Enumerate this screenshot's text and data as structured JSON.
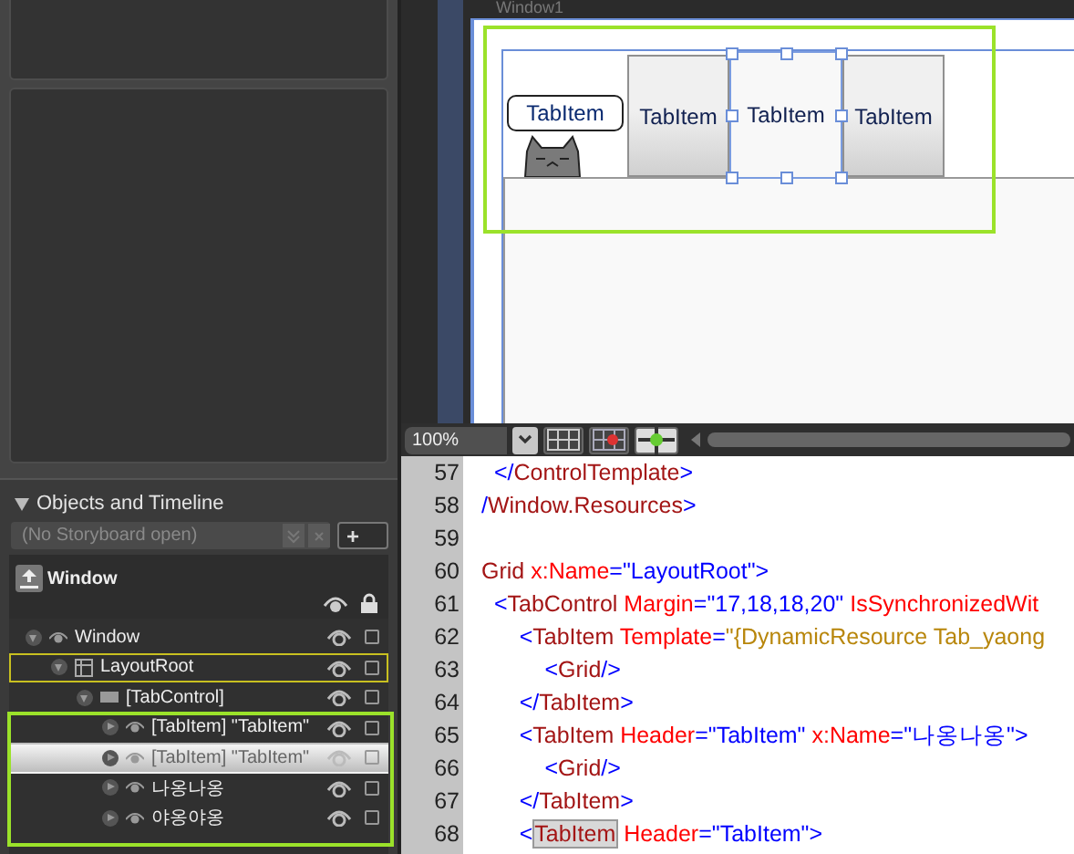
{
  "designer": {
    "window_title": "Window1",
    "tabs": [
      {
        "kind": "bubble",
        "label": "TabItem",
        "selected": false
      },
      {
        "kind": "plain",
        "label": "TabItem",
        "selected": false
      },
      {
        "kind": "plain",
        "label": "TabItem",
        "selected": true
      },
      {
        "kind": "plain",
        "label": "TabItem",
        "selected": false
      }
    ]
  },
  "zoom": {
    "value": "100%"
  },
  "code_editor": {
    "lines": [
      {
        "number": "57",
        "tokens": [
          {
            "kind": "punct",
            "text": "  </"
          },
          {
            "kind": "element",
            "text": "ControlTemplate"
          },
          {
            "kind": "punct",
            "text": ">"
          }
        ]
      },
      {
        "number": "58",
        "tokens": [
          {
            "kind": "punct",
            "text": "/"
          },
          {
            "kind": "element",
            "text": "Window.Resources"
          },
          {
            "kind": "punct",
            "text": ">"
          }
        ]
      },
      {
        "number": "59"
      },
      {
        "number": "60",
        "tokens": [
          {
            "kind": "element",
            "text": "Grid"
          },
          {
            "kind": "attr",
            "text": " x:Name"
          },
          {
            "kind": "punct",
            "text": "="
          },
          {
            "kind": "value",
            "text": "\"LayoutRoot\""
          },
          {
            "kind": "punct",
            "text": ">"
          }
        ]
      },
      {
        "number": "61",
        "tokens": [
          {
            "kind": "punct",
            "text": "  <"
          },
          {
            "kind": "element",
            "text": "TabControl"
          },
          {
            "kind": "attr",
            "text": " Margin"
          },
          {
            "kind": "punct",
            "text": "="
          },
          {
            "kind": "value",
            "text": "\"17,18,18,20\""
          },
          {
            "kind": "attr",
            "text": " IsSynchronizedWit"
          }
        ]
      },
      {
        "number": "62",
        "tokens": [
          {
            "kind": "punct",
            "text": "      <"
          },
          {
            "kind": "element",
            "text": "TabItem"
          },
          {
            "kind": "attr",
            "text": " Template"
          },
          {
            "kind": "punct",
            "text": "="
          },
          {
            "kind": "ext",
            "text": "\"{DynamicResource Tab_yaong"
          }
        ]
      },
      {
        "number": "63",
        "tokens": [
          {
            "kind": "punct",
            "text": "          <"
          },
          {
            "kind": "element",
            "text": "Grid"
          },
          {
            "kind": "punct",
            "text": "/>"
          }
        ]
      },
      {
        "number": "64",
        "tokens": [
          {
            "kind": "punct",
            "text": "      </"
          },
          {
            "kind": "element",
            "text": "TabItem"
          },
          {
            "kind": "punct",
            "text": ">"
          }
        ]
      },
      {
        "number": "65",
        "tokens": [
          {
            "kind": "punct",
            "text": "      <"
          },
          {
            "kind": "element",
            "text": "TabItem"
          },
          {
            "kind": "attr",
            "text": " Header"
          },
          {
            "kind": "punct",
            "text": "="
          },
          {
            "kind": "value",
            "text": "\"TabItem\""
          },
          {
            "kind": "attr",
            "text": " x:Name"
          },
          {
            "kind": "punct",
            "text": "="
          },
          {
            "kind": "value",
            "text": "\"나옹나옹\""
          },
          {
            "kind": "punct",
            "text": ">"
          }
        ]
      },
      {
        "number": "66",
        "tokens": [
          {
            "kind": "punct",
            "text": "          <"
          },
          {
            "kind": "element",
            "text": "Grid"
          },
          {
            "kind": "punct",
            "text": "/>"
          }
        ]
      },
      {
        "number": "67",
        "tokens": [
          {
            "kind": "punct",
            "text": "      </"
          },
          {
            "kind": "element",
            "text": "TabItem"
          },
          {
            "kind": "punct",
            "text": ">"
          }
        ]
      },
      {
        "number": "68",
        "tokens": [
          {
            "kind": "punct",
            "text": "      <"
          },
          {
            "kind": "match",
            "text": "TabItem"
          },
          {
            "kind": "attr",
            "text": " Header"
          },
          {
            "kind": "punct",
            "text": "="
          },
          {
            "kind": "value",
            "text": "\"TabItem\""
          },
          {
            "kind": "punct",
            "text": ">"
          }
        ]
      }
    ]
  },
  "objects_panel": {
    "title": "Objects and Timeline",
    "storyboard": {
      "placeholder": "(No Storyboard open)"
    },
    "add_button": "+",
    "scope": "Window",
    "tree": [
      {
        "label": "Window",
        "kind": "root",
        "expanded": true,
        "selected": false,
        "active": false,
        "children": [
          {
            "label": "LayoutRoot",
            "kind": "panel",
            "expanded": true,
            "selected": false,
            "active": true,
            "children": [
              {
                "label": "[TabControl]",
                "kind": "control",
                "expanded": true,
                "selected": false,
                "active": false,
                "children": [
                  {
                    "label": "[TabItem] \"TabItem\"",
                    "kind": "item",
                    "expanded": false,
                    "selected": false,
                    "active": false
                  },
                  {
                    "label": "[TabItem] \"TabItem\"",
                    "kind": "item",
                    "expanded": false,
                    "selected": true,
                    "active": false
                  },
                  {
                    "label": "나옹나옹",
                    "kind": "item",
                    "expanded": false,
                    "selected": false,
                    "active": false
                  },
                  {
                    "label": "야옹야옹",
                    "kind": "item",
                    "expanded": false,
                    "selected": false,
                    "active": false
                  }
                ]
              }
            ]
          }
        ]
      }
    ]
  }
}
